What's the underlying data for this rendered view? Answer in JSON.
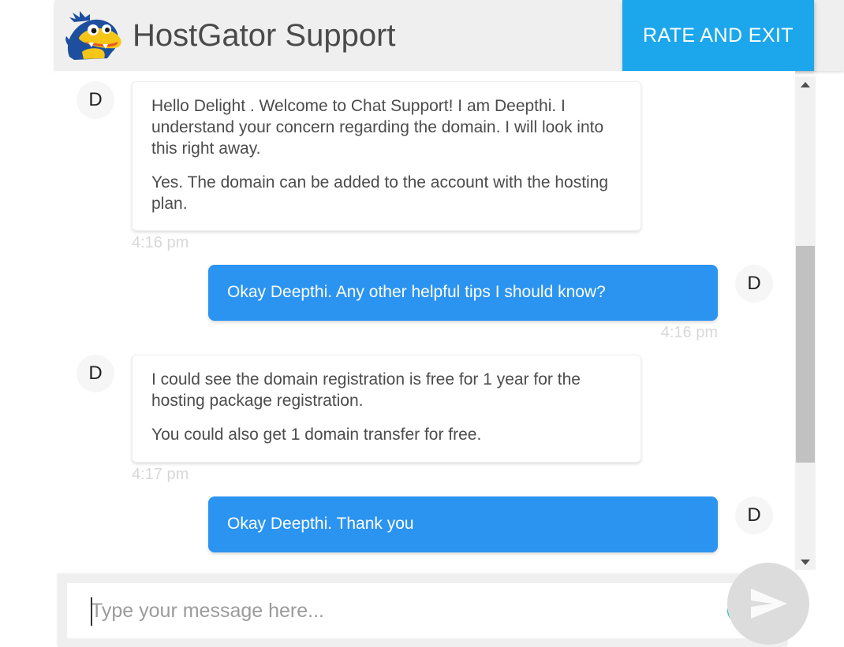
{
  "header": {
    "title": "HostGator Support",
    "logo_icon": "hostgator-alligator-logo",
    "rate_exit_label": "RATE AND EXIT",
    "background_color": "#efefef",
    "accent_color": "#1ca7ec"
  },
  "conversation": {
    "messages": [
      {
        "sender": "agent",
        "avatar_initial": "D",
        "paragraphs": [
          "Hello Delight . Welcome to Chat Support! I am Deepthi. I understand your concern regarding the domain. I will look into this right away.",
          "Yes. The domain can be added to the account with the hosting plan."
        ],
        "timestamp": "4:16 pm"
      },
      {
        "sender": "user",
        "avatar_initial": "D",
        "paragraphs": [
          "Okay Deepthi. Any other helpful tips I should know?"
        ],
        "timestamp": "4:16 pm"
      },
      {
        "sender": "agent",
        "avatar_initial": "D",
        "paragraphs": [
          "I could see the domain registration is free for 1 year for the hosting package registration.",
          "You could also get 1 domain transfer for free."
        ],
        "timestamp": "4:17 pm"
      },
      {
        "sender": "user",
        "avatar_initial": "D",
        "paragraphs": [
          "Okay Deepthi. Thank you"
        ],
        "timestamp": ""
      }
    ],
    "bubble_user_color": "#2b94f0",
    "bubble_agent_color": "#ffffff",
    "timestamp_color": "#d8d8d8"
  },
  "composer": {
    "placeholder": "Type your message here...",
    "value": "",
    "grammarly_icon": "grammarly-g-icon",
    "grammarly_color": "#15c39a",
    "send_icon": "send-paper-plane-icon",
    "send_button_color": "#dcdcdc"
  },
  "scrollbar": {
    "up_arrow_icon": "scroll-up-arrow-icon",
    "down_arrow_icon": "scroll-down-arrow-icon",
    "thumb_color": "#c1c1c1",
    "track_color": "#f1f1f1"
  }
}
